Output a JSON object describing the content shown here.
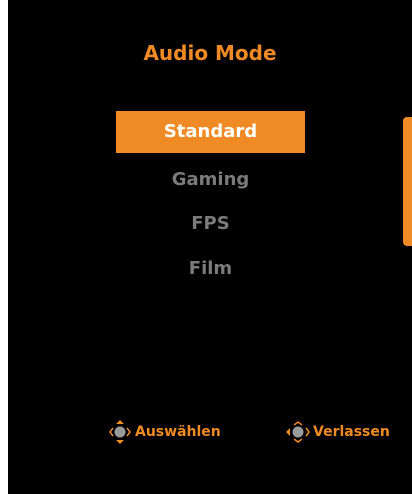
{
  "osd": {
    "title": "Audio Mode",
    "items": [
      {
        "label": "Standard",
        "selected": true
      },
      {
        "label": "Gaming",
        "selected": false
      },
      {
        "label": "FPS",
        "selected": false
      },
      {
        "label": "Film",
        "selected": false
      }
    ],
    "hints": {
      "select": {
        "label": "Auswählen",
        "icon": "joystick-vertical-icon"
      },
      "exit": {
        "label": "Verlassen",
        "icon": "joystick-horizontal-icon"
      }
    }
  },
  "colors": {
    "accent": "#f08a24",
    "background": "#000000",
    "inactive_text": "#7b7b7b",
    "selected_text": "#ffffff"
  }
}
